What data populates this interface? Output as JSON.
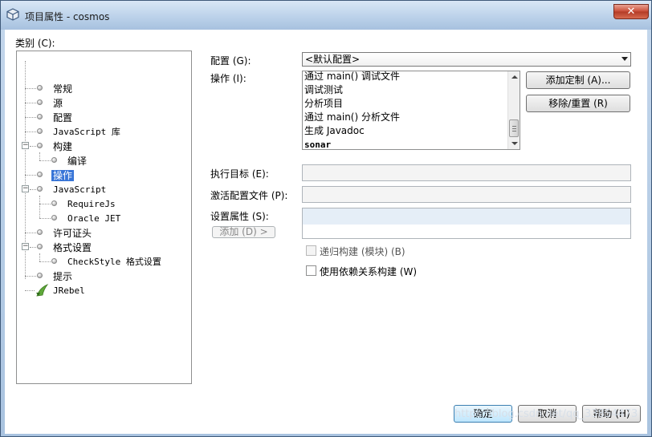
{
  "window": {
    "title": "项目属性 - cosmos",
    "close_glyph": "✕"
  },
  "categories": {
    "label": "类别 (C):",
    "items": [
      {
        "label": "常规"
      },
      {
        "label": "源"
      },
      {
        "label": "配置"
      },
      {
        "label": "JavaScript 库"
      },
      {
        "label": "构建",
        "toggle": "−"
      },
      {
        "label": "编译"
      },
      {
        "label": "操作"
      },
      {
        "label": "JavaScript",
        "toggle": "−"
      },
      {
        "label": "RequireJs"
      },
      {
        "label": "Oracle JET"
      },
      {
        "label": "许可证头"
      },
      {
        "label": "格式设置",
        "toggle": "−"
      },
      {
        "label": "CheckStyle 格式设置"
      },
      {
        "label": "提示"
      },
      {
        "label": "JRebel"
      }
    ]
  },
  "config": {
    "label": "配置 (G):",
    "value": "<默认配置>"
  },
  "actions": {
    "label": "操作 (I):",
    "items": [
      "通过 main() 调试文件",
      "调试测试",
      "分析项目",
      "通过 main() 分析文件",
      "生成 Javadoc",
      "sonar"
    ],
    "add_custom": "添加定制 (A)...",
    "remove_reset": "移除/重置 (R)"
  },
  "fields": {
    "exec_goals": "执行目标 (E):",
    "activate_profiles": "激活配置文件 (P):",
    "set_props": "设置属性 (S):",
    "add_button": "添加 (D) >"
  },
  "options": {
    "recursive": "递归构建 (模块) (B)",
    "build_with_deps": "使用依赖关系构建 (W)"
  },
  "footer": {
    "ok": "确定",
    "cancel": "取消",
    "help": "帮助 (H)"
  },
  "watermark": "https://blog.csdn.net/qq_33854473"
}
